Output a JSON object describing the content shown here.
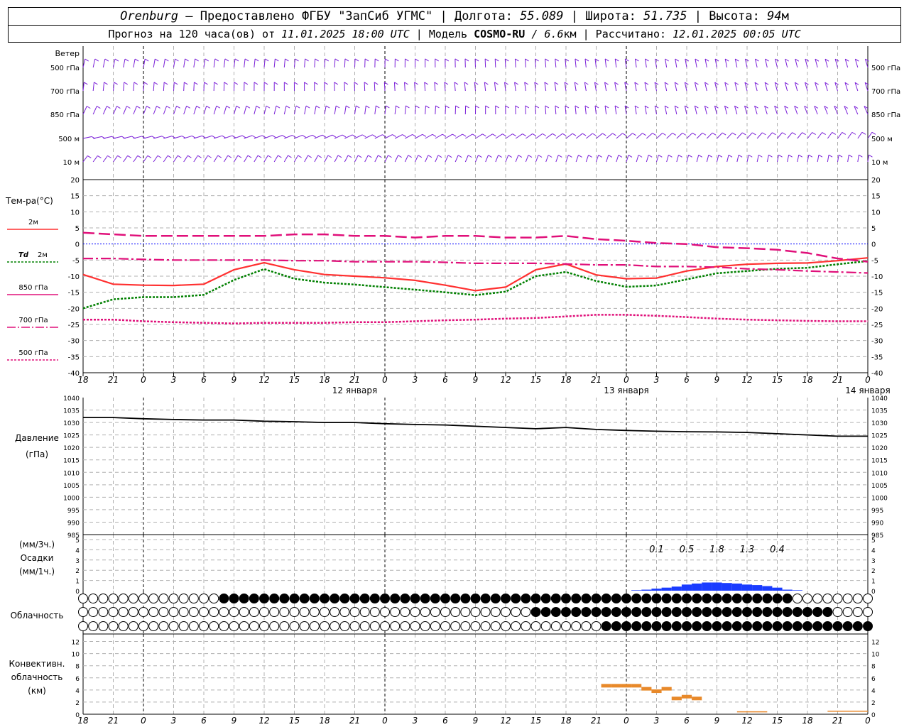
{
  "header": {
    "station": "Orenburg",
    "provider": " — Предоставлено ФГБУ \"ЗапСиб УГМС\" | Долгота: ",
    "lon": "55.089",
    "lat_label": " | Широта: ",
    "lat": "51.735",
    "alt_label": " | Высота: ",
    "alt": "94",
    "alt_unit": "м",
    "forecast_label": "Прогноз на 120 часа(ов) от ",
    "forecast_from": "11.01.2025 18:00 UTC",
    "model_label": " | Модель ",
    "model": "COSMO-RU",
    "model_res": " / 6.6",
    "model_res_unit": "км",
    "computed_label": " | Рассчитано: ",
    "computed": "12.01.2025 00:05 UTC"
  },
  "labels": {
    "wind": "Ветер",
    "wind_levels": [
      "500 гПа",
      "700 гПа",
      "850 гПа",
      "500 м",
      "10 м"
    ],
    "temp": "Тем-ра(°C)",
    "t2m": "2м",
    "td_a": "Td",
    "td_b": "2м",
    "l850": "850 гПа",
    "l700": "700 гПа",
    "l500": "500 гПа",
    "pressure_a": "Давление",
    "pressure_b": "(гПа)",
    "precip_a": "(мм/3ч.)",
    "precip_b": "Осадки",
    "precip_c": "(мм/1ч.)",
    "cloud": "Облачность",
    "conv_a": "Конвективн.",
    "conv_b": "облачность",
    "conv_c": "(км)"
  },
  "colors": {
    "t2m": "#ff3030",
    "td2m": "#008000",
    "levels": "#e0107a",
    "wind": "#7a1fd8",
    "pressure": "#000000",
    "precip": "#1a3cff",
    "convective": "#e8892a",
    "zero_line": "#0000ff"
  },
  "chart_data": {
    "type": "line",
    "x_ticks": [
      "18",
      "21",
      "0",
      "3",
      "6",
      "9",
      "12",
      "15",
      "18",
      "21",
      "0",
      "3",
      "6",
      "9",
      "12",
      "15",
      "18",
      "21",
      "0",
      "3",
      "6",
      "9",
      "12",
      "15",
      "18",
      "21",
      "0"
    ],
    "day_labels": [
      "12 января",
      "13 января",
      "14 января"
    ],
    "hours": [
      0,
      3,
      6,
      9,
      12,
      15,
      18,
      21,
      24,
      27,
      30,
      33,
      36,
      39,
      42,
      45,
      48,
      51,
      54,
      57,
      60,
      63,
      66,
      69,
      72,
      75,
      78
    ],
    "temperature": {
      "ylim": [
        -40,
        20
      ],
      "ticks": [
        20,
        15,
        10,
        5,
        0,
        -5,
        -10,
        -15,
        -20,
        -25,
        -30,
        -35,
        -40
      ],
      "series": [
        {
          "name": "2м",
          "values": [
            -9.5,
            -12.5,
            -12.8,
            -12.9,
            -12.5,
            -8,
            -5.8,
            -8,
            -9.5,
            -10,
            -10.5,
            -11.3,
            -12.8,
            -14.5,
            -13.4,
            -8,
            -6.2,
            -9.6,
            -10.8,
            -10.6,
            -8.4,
            -7,
            -6.3,
            -6,
            -5.9,
            -5.2,
            -4.3
          ]
        },
        {
          "name": "Td 2м",
          "values": [
            -20,
            -17.2,
            -16.5,
            -16.5,
            -15.8,
            -11.2,
            -7.8,
            -10.8,
            -12,
            -12.6,
            -13.4,
            -14.2,
            -15,
            -15.9,
            -14.8,
            -10,
            -8.7,
            -11.5,
            -13.3,
            -12.9,
            -11,
            -9.1,
            -8.4,
            -7.7,
            -7.4,
            -6.3,
            -5.3
          ]
        },
        {
          "name": "850 гПа",
          "values": [
            3.5,
            3,
            2.5,
            2.5,
            2.5,
            2.5,
            2.5,
            3,
            3,
            2.5,
            2.5,
            2,
            2.5,
            2.5,
            2,
            2,
            2.5,
            1.5,
            1,
            0.3,
            0,
            -1,
            -1.3,
            -1.8,
            -2.8,
            -4.5,
            -5.5
          ]
        },
        {
          "name": "700 гПа",
          "values": [
            -4.5,
            -4.5,
            -4.8,
            -5,
            -5,
            -5,
            -5,
            -5.2,
            -5.2,
            -5.5,
            -5.5,
            -5.5,
            -5.7,
            -6,
            -6,
            -6,
            -6.2,
            -6.5,
            -6.5,
            -7,
            -7,
            -7.2,
            -7.7,
            -8,
            -8.4,
            -8.7,
            -9
          ]
        },
        {
          "name": "500 гПа",
          "values": [
            -23.5,
            -23.5,
            -24,
            -24.3,
            -24.5,
            -24.7,
            -24.5,
            -24.5,
            -24.5,
            -24.3,
            -24.3,
            -24,
            -23.7,
            -23.5,
            -23.2,
            -23,
            -22.5,
            -22,
            -22,
            -22.3,
            -22.7,
            -23.2,
            -23.5,
            -23.7,
            -23.9,
            -24,
            -24
          ]
        }
      ]
    },
    "pressure": {
      "ylim": [
        985,
        1040
      ],
      "ticks": [
        1040,
        1035,
        1030,
        1025,
        1020,
        1015,
        1010,
        1005,
        1000,
        995,
        990,
        985
      ],
      "values": [
        1032,
        1032,
        1031.5,
        1031.2,
        1031,
        1031,
        1030.5,
        1030.3,
        1030,
        1030,
        1029.5,
        1029.2,
        1029,
        1028.5,
        1028,
        1027.5,
        1028,
        1027.2,
        1026.8,
        1026.5,
        1026.3,
        1026.2,
        1026,
        1025.5,
        1025,
        1024.5,
        1024.5
      ]
    },
    "precip": {
      "ylim": [
        0,
        5
      ],
      "ticks": [
        5,
        4,
        3,
        2,
        1,
        0
      ],
      "labels_3h": [
        "0.1",
        "0.5",
        "1.8",
        "1.3",
        "0.4"
      ],
      "values_1h": [
        0.05,
        0.1,
        0.2,
        0.3,
        0.4,
        0.6,
        0.7,
        0.8,
        0.8,
        0.75,
        0.7,
        0.6,
        0.55,
        0.45,
        0.3,
        0.1,
        0.05
      ]
    },
    "convective": {
      "ylim": [
        0,
        13
      ],
      "ticks": [
        12,
        10,
        8,
        6,
        4,
        2,
        0
      ]
    }
  }
}
